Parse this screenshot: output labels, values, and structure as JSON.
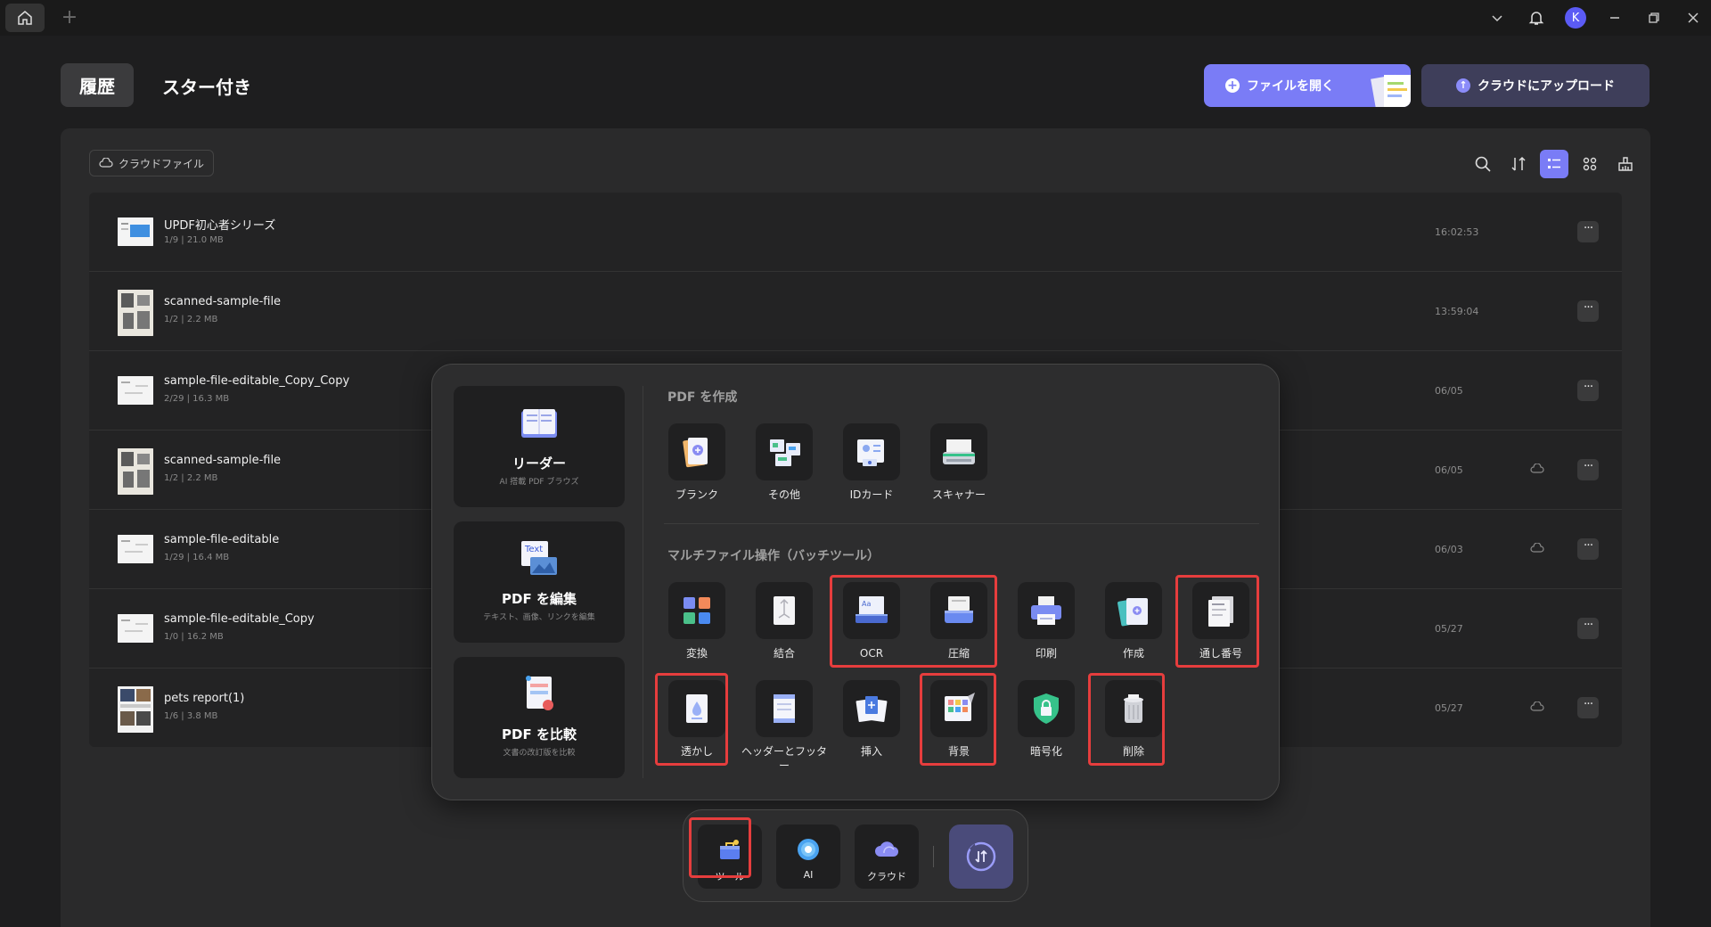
{
  "titlebar": {
    "avatar_letter": "K"
  },
  "tabs": {
    "history": "履歴",
    "starred": "スター付き"
  },
  "actions": {
    "open_file": "ファイルを開く",
    "upload_cloud": "クラウドにアップロード"
  },
  "toolbar": {
    "cloud_files": "クラウドファイル"
  },
  "files": [
    {
      "name": "UPDF初心者シリーズ",
      "meta": "1/9 | 21.0 MB",
      "date": "16:02:53",
      "cloud": false
    },
    {
      "name": "scanned-sample-file",
      "meta": "1/2 | 2.2 MB",
      "date": "13:59:04",
      "cloud": false
    },
    {
      "name": "sample-file-editable_Copy_Copy",
      "meta": "2/29 | 16.3 MB",
      "date": "06/05",
      "cloud": false
    },
    {
      "name": "scanned-sample-file",
      "meta": "1/2 | 2.2 MB",
      "date": "06/05",
      "cloud": true
    },
    {
      "name": "sample-file-editable",
      "meta": "1/29 | 16.4 MB",
      "date": "06/03",
      "cloud": true
    },
    {
      "name": "sample-file-editable_Copy",
      "meta": "1/0 | 16.2 MB",
      "date": "05/27",
      "cloud": false
    },
    {
      "name": "pets report(1)",
      "meta": "1/6 | 3.8 MB",
      "date": "05/27",
      "cloud": true
    }
  ],
  "popup": {
    "cards": [
      {
        "title": "リーダー",
        "subtitle": "AI 搭載 PDF ブラウズ"
      },
      {
        "title": "PDF を編集",
        "subtitle": "テキスト、画像、リンクを編集"
      },
      {
        "title": "PDF を比較",
        "subtitle": "文書の改訂版を比較"
      }
    ],
    "create_title": "PDF を作成",
    "create_tools": [
      "ブランク",
      "その他",
      "IDカード",
      "スキャナー"
    ],
    "batch_title": "マルチファイル操作（バッチツール）",
    "batch_row1": [
      "変換",
      "結合",
      "OCR",
      "圧縮",
      "印刷",
      "作成",
      "通し番号"
    ],
    "batch_row2": [
      "透かし",
      "ヘッダーとフッター",
      "挿入",
      "背景",
      "暗号化",
      "削除"
    ]
  },
  "dock": {
    "tools": "ツール",
    "ai": "AI",
    "cloud": "クラウド"
  }
}
